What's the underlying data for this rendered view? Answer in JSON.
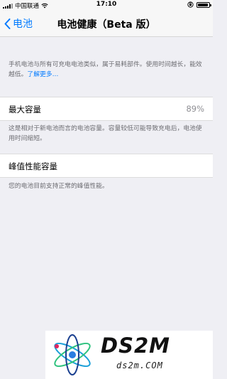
{
  "status_bar": {
    "carrier": "中国联通",
    "time": "17:10",
    "battery_level": 0.9
  },
  "nav": {
    "back_label": "电池",
    "title": "电池健康（Beta 版）"
  },
  "intro": {
    "text": "手机电池与所有可充电电池类似，属于易耗部件。使用时间越长，能效越低。",
    "link": "了解更多…"
  },
  "max_capacity": {
    "label": "最大容量",
    "value": "89%",
    "description": "这是相对于新电池而言的电池容量。容量较低可能导致充电后，电池使用时间缩短。"
  },
  "peak_performance": {
    "label": "峰值性能容量",
    "description": "您的电池目前支持正常的峰值性能。"
  },
  "watermark": {
    "brand": "DS2M",
    "url": "ds2m.COM"
  },
  "colors": {
    "accent": "#007aff",
    "background": "#efeff4",
    "secondary_text": "#6d6d72"
  },
  "icons": [
    "signal-icon",
    "wifi-icon",
    "orientation-lock-icon",
    "battery-icon",
    "chevron-left-icon",
    "watermark-logo-icon"
  ]
}
